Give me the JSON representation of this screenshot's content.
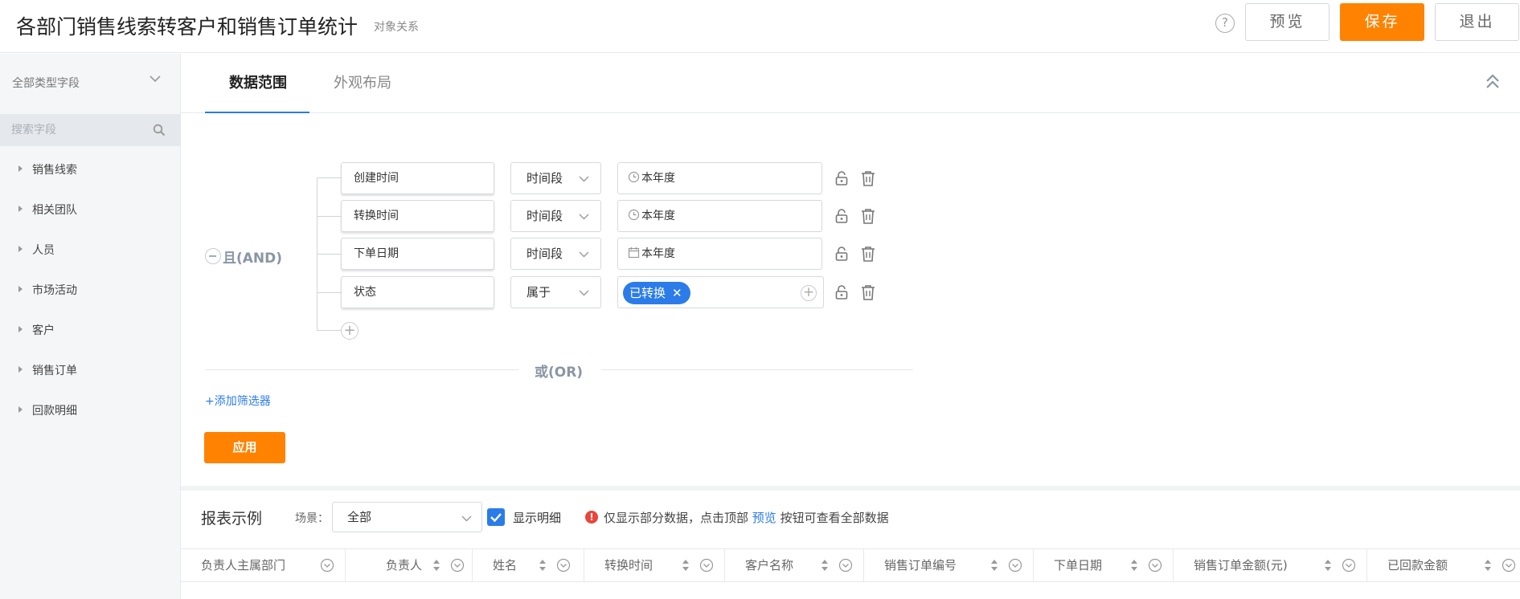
{
  "header": {
    "title": "各部门销售线索转客户和销售订单统计",
    "subtitle": "对象关系",
    "help": "?",
    "preview_label": "预览",
    "save_label": "保存",
    "exit_label": "退出"
  },
  "sidebar": {
    "field_type": "全部类型字段",
    "search_placeholder": "搜索字段",
    "items": [
      {
        "label": "销售线索"
      },
      {
        "label": "相关团队"
      },
      {
        "label": "人员"
      },
      {
        "label": "市场活动"
      },
      {
        "label": "客户"
      },
      {
        "label": "销售订单"
      },
      {
        "label": "回款明细"
      }
    ]
  },
  "tabs": {
    "data_range": "数据范围",
    "layout": "外观布局"
  },
  "filters": {
    "and_label": "且(AND)",
    "rows": [
      {
        "field": "创建时间",
        "operator": "时间段",
        "value": "本年度",
        "value_icon": "clock-icon"
      },
      {
        "field": "转换时间",
        "operator": "时间段",
        "value": "本年度",
        "value_icon": "clock-icon"
      },
      {
        "field": "下单日期",
        "operator": "时间段",
        "value": "本年度",
        "value_icon": "calendar-icon"
      },
      {
        "field": "状态",
        "operator": "属于",
        "tag": "已转换",
        "tag_close": "✕"
      }
    ],
    "plus": "+",
    "or_label": "或(OR)",
    "add_filter": "+添加筛选器",
    "apply_label": "应用"
  },
  "report": {
    "title": "报表示例",
    "scene_label": "场景：",
    "scene_value": "全部",
    "show_detail": "显示明细",
    "warn": "!",
    "notice_before": "仅显示部分数据，点击顶部",
    "notice_link": "预览",
    "notice_after": "按钮可查看全部数据",
    "columns": [
      {
        "label": "负责人主属部门",
        "sortable": false
      },
      {
        "label": "负责人",
        "sortable": true
      },
      {
        "label": "姓名",
        "sortable": true
      },
      {
        "label": "转换时间",
        "sortable": true
      },
      {
        "label": "客户名称",
        "sortable": true
      },
      {
        "label": "销售订单编号",
        "sortable": true
      },
      {
        "label": "下单日期",
        "sortable": true
      },
      {
        "label": "销售订单金额(元)",
        "sortable": true
      },
      {
        "label": "已回款金额",
        "sortable": true
      }
    ]
  },
  "colors": {
    "accent": "#2b7ce9",
    "primary_button": "#ff8200",
    "warning": "#e9453a"
  }
}
